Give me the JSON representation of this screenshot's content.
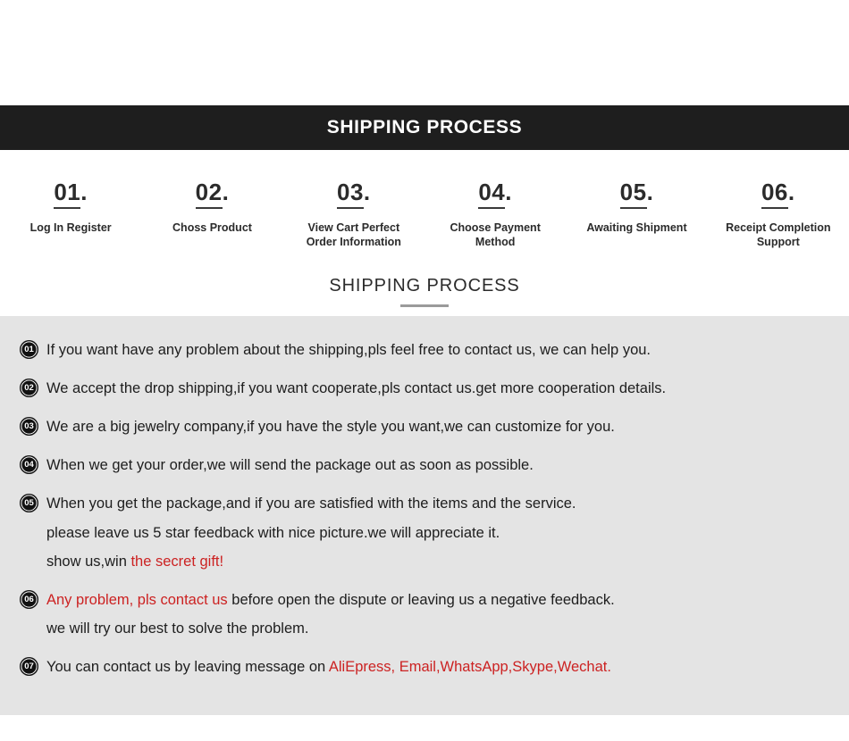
{
  "banner": {
    "title": "SHIPPING PROCESS"
  },
  "steps": [
    {
      "number": "01",
      "dot": ".",
      "label": "Log In Register"
    },
    {
      "number": "02",
      "dot": ".",
      "label": "Choss Product"
    },
    {
      "number": "03",
      "dot": ".",
      "label": "View Cart Perfect\nOrder Information"
    },
    {
      "number": "04",
      "dot": ".",
      "label": "Choose Payment\nMethod"
    },
    {
      "number": "05",
      "dot": ".",
      "label": "Awaiting Shipment"
    },
    {
      "number": "06",
      "dot": ".",
      "label": "Receipt Completion\nSupport"
    }
  ],
  "section": {
    "title": "SHIPPING PROCESS"
  },
  "faq": [
    {
      "badge": "01",
      "lines": [
        [
          {
            "text": "If you want have any problem about the shipping,pls feel free to contact us, we can help you.",
            "color": "black"
          }
        ]
      ]
    },
    {
      "badge": "02",
      "lines": [
        [
          {
            "text": "We accept the drop shipping,if you want cooperate,pls contact us.get more cooperation details.",
            "color": "black"
          }
        ]
      ]
    },
    {
      "badge": "03",
      "lines": [
        [
          {
            "text": "We are a big jewelry company,if you have the style you want,we can customize for you.",
            "color": "black"
          }
        ]
      ]
    },
    {
      "badge": "04",
      "lines": [
        [
          {
            "text": "When we get your order,we will send the package out as soon as possible.",
            "color": "black"
          }
        ]
      ]
    },
    {
      "badge": "05",
      "lines": [
        [
          {
            "text": "When you get the package,and if you are satisfied with the items and the service.",
            "color": "black"
          }
        ],
        [
          {
            "text": "please leave us 5 star feedback with nice picture.we will appreciate it.",
            "color": "black"
          }
        ],
        [
          {
            "text": "show us,win ",
            "color": "black"
          },
          {
            "text": "the secret gift!",
            "color": "red"
          }
        ]
      ]
    },
    {
      "badge": "06",
      "lines": [
        [
          {
            "text": "Any problem, pls contact us",
            "color": "red"
          },
          {
            "text": " before open the dispute or leaving us a negative feedback.",
            "color": "black"
          }
        ],
        [
          {
            "text": "we will try our best to solve the problem.",
            "color": "black"
          }
        ]
      ]
    },
    {
      "badge": "07",
      "lines": [
        [
          {
            "text": "You can contact us by leaving message on ",
            "color": "black"
          },
          {
            "text": "AliEpress, Email,WhatsApp,Skype,Wechat.",
            "color": "red"
          }
        ]
      ]
    }
  ],
  "colors": {
    "banner_bg": "#1e1e1e",
    "panel_bg": "#e4e4e4",
    "accent_red": "#cc2222",
    "text_dark": "#1d1d1d",
    "rule_gray": "#9a9a9a"
  }
}
